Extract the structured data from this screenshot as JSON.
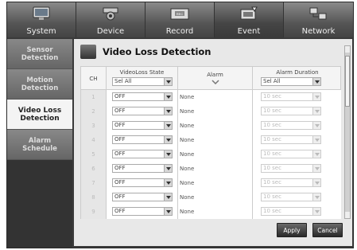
{
  "top_tabs": [
    {
      "label": "System",
      "icon": "monitor-icon"
    },
    {
      "label": "Device",
      "icon": "camera-icon"
    },
    {
      "label": "Record",
      "icon": "recorder-icon"
    },
    {
      "label": "Event",
      "icon": "event-icon"
    },
    {
      "label": "Network",
      "icon": "network-icon"
    }
  ],
  "side_menu": [
    {
      "label": "Sensor Detection"
    },
    {
      "label": "Motion Detection"
    },
    {
      "label": "Video Loss Detection"
    },
    {
      "label": "Alarm Schedule"
    }
  ],
  "page": {
    "title": "Video Loss Detection"
  },
  "table": {
    "col_ch": "CH",
    "col_state": "VideoLoss State",
    "state_all": "Sel All",
    "col_alarm": "Alarm",
    "col_duration": "Alarm Duration",
    "duration_all": "Sel All",
    "rows": [
      {
        "ch": "1",
        "state": "OFF",
        "alarm": "None",
        "duration": "10 sec"
      },
      {
        "ch": "2",
        "state": "OFF",
        "alarm": "None",
        "duration": "10 sec"
      },
      {
        "ch": "3",
        "state": "OFF",
        "alarm": "None",
        "duration": "10 sec"
      },
      {
        "ch": "4",
        "state": "OFF",
        "alarm": "None",
        "duration": "10 sec"
      },
      {
        "ch": "5",
        "state": "OFF",
        "alarm": "None",
        "duration": "10 sec"
      },
      {
        "ch": "6",
        "state": "OFF",
        "alarm": "None",
        "duration": "10 sec"
      },
      {
        "ch": "7",
        "state": "OFF",
        "alarm": "None",
        "duration": "10 sec"
      },
      {
        "ch": "8",
        "state": "OFF",
        "alarm": "None",
        "duration": "10 sec"
      },
      {
        "ch": "9",
        "state": "OFF",
        "alarm": "None",
        "duration": "10 sec"
      }
    ]
  },
  "buttons": {
    "apply": "Apply",
    "cancel": "Cancel"
  }
}
